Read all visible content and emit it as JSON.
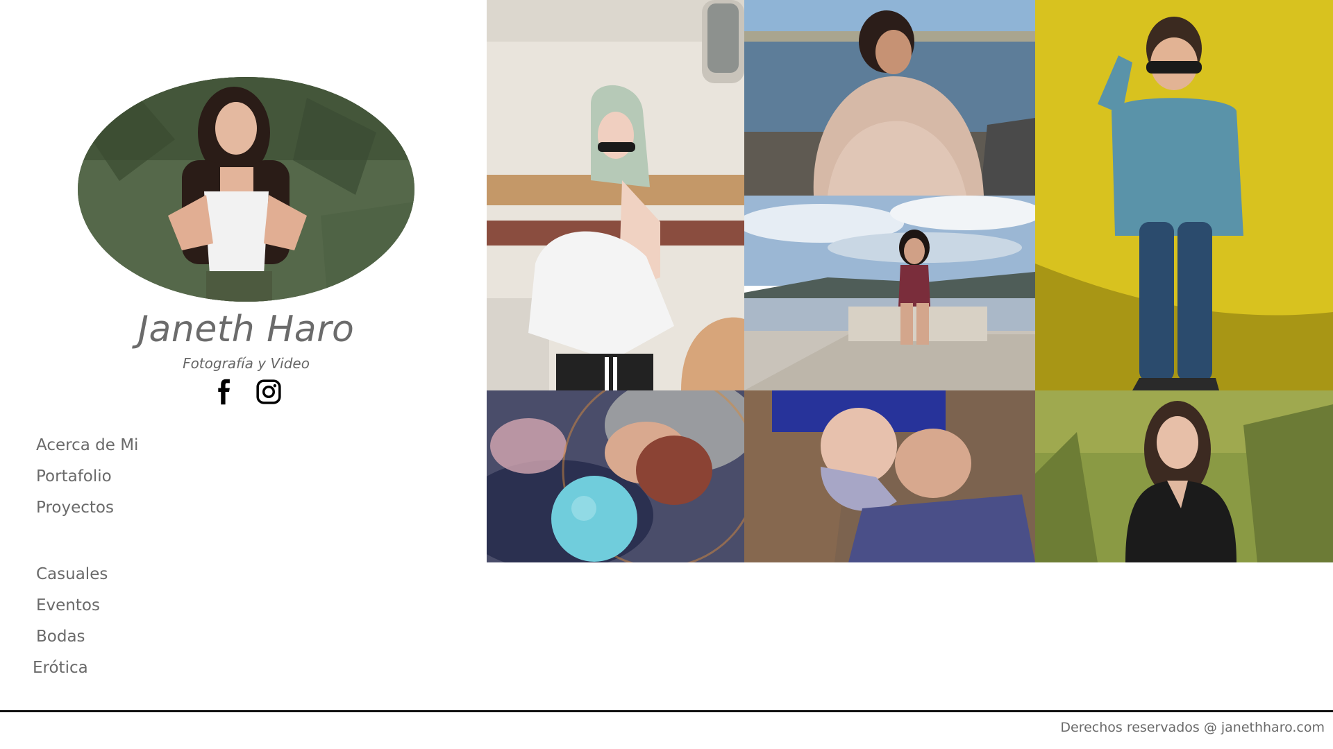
{
  "brand": {
    "name": "Janeth Haro",
    "tagline": "Fotografía y Video"
  },
  "social": [
    {
      "name": "facebook-icon"
    },
    {
      "name": "instagram-icon"
    }
  ],
  "nav": {
    "primary": [
      "Acerca de Mi",
      "Portafolio",
      "Proyectos"
    ],
    "secondary": [
      "Casuales",
      "Eventos",
      "Bodas",
      "Erótica"
    ]
  },
  "gallery": [
    {
      "subject": "woman with sunglasses by trailer"
    },
    {
      "subject": "older woman in blanket by lake"
    },
    {
      "subject": "boy with sunglasses on yellow wall"
    },
    {
      "subject": "woman sitting by lake"
    },
    {
      "subject": "woman with glowing moon lamp"
    },
    {
      "subject": "elderly couple lying on leaves"
    },
    {
      "subject": "woman in grass field"
    }
  ],
  "footer": {
    "copyright": "Derechos reservados @ janethharo.com"
  },
  "colors": {
    "text_gray": "#6a6a6a",
    "footer_line": "#111111",
    "background": "#ffffff"
  }
}
